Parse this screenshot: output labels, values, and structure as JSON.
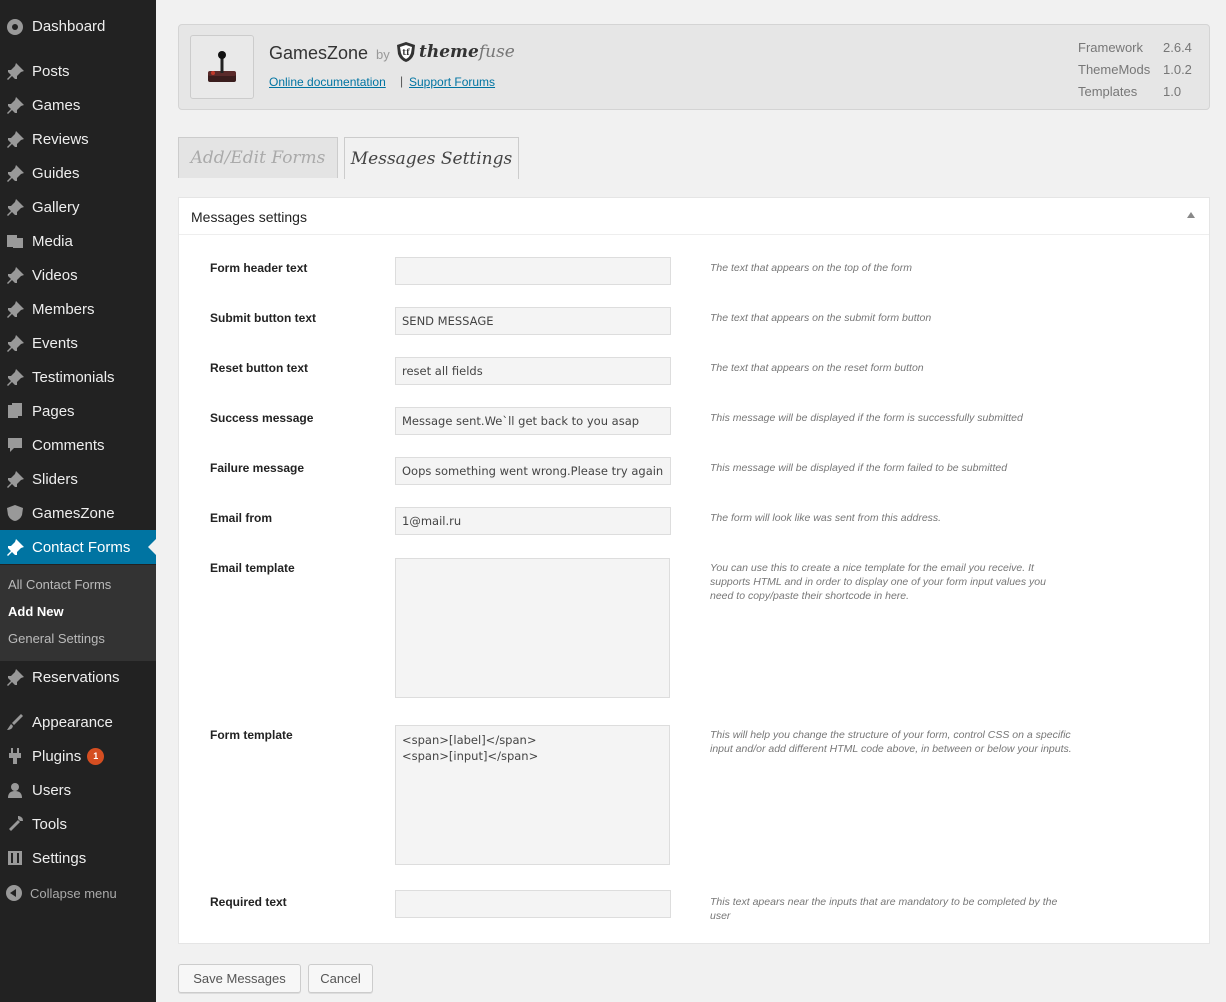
{
  "sidebar": {
    "items": [
      {
        "label": "Dashboard",
        "icon": "dashboard-icon"
      },
      {
        "label": "Posts",
        "icon": "pin-icon"
      },
      {
        "label": "Games",
        "icon": "pin-icon"
      },
      {
        "label": "Reviews",
        "icon": "pin-icon"
      },
      {
        "label": "Guides",
        "icon": "pin-icon"
      },
      {
        "label": "Gallery",
        "icon": "pin-icon"
      },
      {
        "label": "Media",
        "icon": "media-icon"
      },
      {
        "label": "Videos",
        "icon": "pin-icon"
      },
      {
        "label": "Members",
        "icon": "pin-icon"
      },
      {
        "label": "Events",
        "icon": "pin-icon"
      },
      {
        "label": "Testimonials",
        "icon": "pin-icon"
      },
      {
        "label": "Pages",
        "icon": "pages-icon"
      },
      {
        "label": "Comments",
        "icon": "comment-icon"
      },
      {
        "label": "Sliders",
        "icon": "pin-icon"
      },
      {
        "label": "GamesZone",
        "icon": "shield-icon"
      },
      {
        "label": "Contact Forms",
        "icon": "pin-icon"
      },
      {
        "label": "Reservations",
        "icon": "pin-icon"
      },
      {
        "label": "Appearance",
        "icon": "brush-icon"
      },
      {
        "label": "Plugins",
        "icon": "plug-icon",
        "badge": "1"
      },
      {
        "label": "Users",
        "icon": "user-icon"
      },
      {
        "label": "Tools",
        "icon": "wrench-icon"
      },
      {
        "label": "Settings",
        "icon": "settings-icon"
      }
    ],
    "submenu": [
      {
        "label": "All Contact Forms"
      },
      {
        "label": "Add New"
      },
      {
        "label": "General Settings"
      }
    ],
    "collapse_label": "Collapse menu"
  },
  "header": {
    "theme_name": "GamesZone",
    "by": "by",
    "brand_a": "theme",
    "brand_b": "fuse",
    "link_docs": "Online documentation",
    "link_sep": "|",
    "link_forums": "Support Forums",
    "versions": [
      {
        "label": "Framework",
        "value": "2.6.4"
      },
      {
        "label": "ThemeMods",
        "value": "1.0.2"
      },
      {
        "label": "Templates",
        "value": "1.0"
      }
    ]
  },
  "tabs": {
    "add_edit": "Add/Edit Forms",
    "messages": "Messages Settings"
  },
  "panel": {
    "title": "Messages settings",
    "fields": [
      {
        "label": "Form header text",
        "value": "",
        "desc": "The text that appears on the top of the form"
      },
      {
        "label": "Submit button text",
        "value": "SEND MESSAGE",
        "desc": "The text that appears on the submit form button"
      },
      {
        "label": "Reset button text",
        "value": "reset all fields",
        "desc": "The text that appears on the reset form button"
      },
      {
        "label": "Success message",
        "value": "Message sent.We`ll get back to you asap",
        "desc": "This message will be displayed if the form is successfully submitted"
      },
      {
        "label": "Failure message",
        "value": "Oops something went wrong.Please try again",
        "desc": "This message will be displayed if the form failed to be submitted"
      },
      {
        "label": "Email from",
        "value": "1@mail.ru",
        "desc": "The form will look like was sent from this address."
      },
      {
        "label": "Email template",
        "value": "",
        "desc": "You can use this to create a nice template for the email you receive. It supports HTML and in order to display one of your form input values you need to copy/paste their shortcode in here."
      },
      {
        "label": "Form template",
        "value": "<span>[label]</span>\n<span>[input]</span>",
        "desc": "This will help you change the structure of your form, control CSS on a specific input and/or add different HTML code above, in between or below your inputs."
      },
      {
        "label": "Required text",
        "value": "",
        "desc": "This text apears near the inputs that are mandatory to be completed by the user"
      }
    ]
  },
  "buttons": {
    "save": "Save Messages",
    "cancel": "Cancel"
  },
  "colors": {
    "sidebar_bg": "#222222",
    "accent": "#0074a2",
    "badge": "#d54e21"
  }
}
